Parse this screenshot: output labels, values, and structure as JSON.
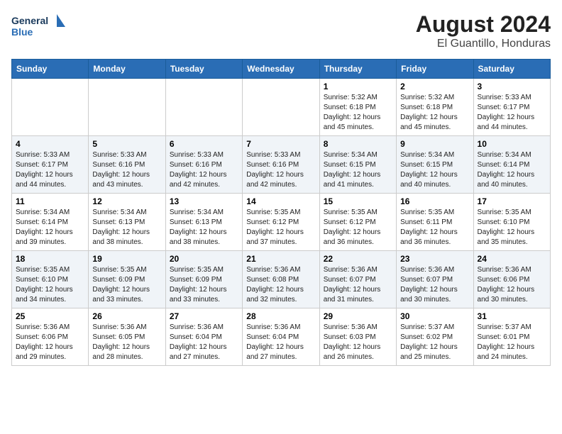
{
  "logo": {
    "line1": "General",
    "line2": "Blue"
  },
  "title": "August 2024",
  "subtitle": "El Guantillo, Honduras",
  "weekdays": [
    "Sunday",
    "Monday",
    "Tuesday",
    "Wednesday",
    "Thursday",
    "Friday",
    "Saturday"
  ],
  "weeks": [
    [
      {
        "day": "",
        "info": ""
      },
      {
        "day": "",
        "info": ""
      },
      {
        "day": "",
        "info": ""
      },
      {
        "day": "",
        "info": ""
      },
      {
        "day": "1",
        "info": "Sunrise: 5:32 AM\nSunset: 6:18 PM\nDaylight: 12 hours\nand 45 minutes."
      },
      {
        "day": "2",
        "info": "Sunrise: 5:32 AM\nSunset: 6:18 PM\nDaylight: 12 hours\nand 45 minutes."
      },
      {
        "day": "3",
        "info": "Sunrise: 5:33 AM\nSunset: 6:17 PM\nDaylight: 12 hours\nand 44 minutes."
      }
    ],
    [
      {
        "day": "4",
        "info": "Sunrise: 5:33 AM\nSunset: 6:17 PM\nDaylight: 12 hours\nand 44 minutes."
      },
      {
        "day": "5",
        "info": "Sunrise: 5:33 AM\nSunset: 6:16 PM\nDaylight: 12 hours\nand 43 minutes."
      },
      {
        "day": "6",
        "info": "Sunrise: 5:33 AM\nSunset: 6:16 PM\nDaylight: 12 hours\nand 42 minutes."
      },
      {
        "day": "7",
        "info": "Sunrise: 5:33 AM\nSunset: 6:16 PM\nDaylight: 12 hours\nand 42 minutes."
      },
      {
        "day": "8",
        "info": "Sunrise: 5:34 AM\nSunset: 6:15 PM\nDaylight: 12 hours\nand 41 minutes."
      },
      {
        "day": "9",
        "info": "Sunrise: 5:34 AM\nSunset: 6:15 PM\nDaylight: 12 hours\nand 40 minutes."
      },
      {
        "day": "10",
        "info": "Sunrise: 5:34 AM\nSunset: 6:14 PM\nDaylight: 12 hours\nand 40 minutes."
      }
    ],
    [
      {
        "day": "11",
        "info": "Sunrise: 5:34 AM\nSunset: 6:14 PM\nDaylight: 12 hours\nand 39 minutes."
      },
      {
        "day": "12",
        "info": "Sunrise: 5:34 AM\nSunset: 6:13 PM\nDaylight: 12 hours\nand 38 minutes."
      },
      {
        "day": "13",
        "info": "Sunrise: 5:34 AM\nSunset: 6:13 PM\nDaylight: 12 hours\nand 38 minutes."
      },
      {
        "day": "14",
        "info": "Sunrise: 5:35 AM\nSunset: 6:12 PM\nDaylight: 12 hours\nand 37 minutes."
      },
      {
        "day": "15",
        "info": "Sunrise: 5:35 AM\nSunset: 6:12 PM\nDaylight: 12 hours\nand 36 minutes."
      },
      {
        "day": "16",
        "info": "Sunrise: 5:35 AM\nSunset: 6:11 PM\nDaylight: 12 hours\nand 36 minutes."
      },
      {
        "day": "17",
        "info": "Sunrise: 5:35 AM\nSunset: 6:10 PM\nDaylight: 12 hours\nand 35 minutes."
      }
    ],
    [
      {
        "day": "18",
        "info": "Sunrise: 5:35 AM\nSunset: 6:10 PM\nDaylight: 12 hours\nand 34 minutes."
      },
      {
        "day": "19",
        "info": "Sunrise: 5:35 AM\nSunset: 6:09 PM\nDaylight: 12 hours\nand 33 minutes."
      },
      {
        "day": "20",
        "info": "Sunrise: 5:35 AM\nSunset: 6:09 PM\nDaylight: 12 hours\nand 33 minutes."
      },
      {
        "day": "21",
        "info": "Sunrise: 5:36 AM\nSunset: 6:08 PM\nDaylight: 12 hours\nand 32 minutes."
      },
      {
        "day": "22",
        "info": "Sunrise: 5:36 AM\nSunset: 6:07 PM\nDaylight: 12 hours\nand 31 minutes."
      },
      {
        "day": "23",
        "info": "Sunrise: 5:36 AM\nSunset: 6:07 PM\nDaylight: 12 hours\nand 30 minutes."
      },
      {
        "day": "24",
        "info": "Sunrise: 5:36 AM\nSunset: 6:06 PM\nDaylight: 12 hours\nand 30 minutes."
      }
    ],
    [
      {
        "day": "25",
        "info": "Sunrise: 5:36 AM\nSunset: 6:06 PM\nDaylight: 12 hours\nand 29 minutes."
      },
      {
        "day": "26",
        "info": "Sunrise: 5:36 AM\nSunset: 6:05 PM\nDaylight: 12 hours\nand 28 minutes."
      },
      {
        "day": "27",
        "info": "Sunrise: 5:36 AM\nSunset: 6:04 PM\nDaylight: 12 hours\nand 27 minutes."
      },
      {
        "day": "28",
        "info": "Sunrise: 5:36 AM\nSunset: 6:04 PM\nDaylight: 12 hours\nand 27 minutes."
      },
      {
        "day": "29",
        "info": "Sunrise: 5:36 AM\nSunset: 6:03 PM\nDaylight: 12 hours\nand 26 minutes."
      },
      {
        "day": "30",
        "info": "Sunrise: 5:37 AM\nSunset: 6:02 PM\nDaylight: 12 hours\nand 25 minutes."
      },
      {
        "day": "31",
        "info": "Sunrise: 5:37 AM\nSunset: 6:01 PM\nDaylight: 12 hours\nand 24 minutes."
      }
    ]
  ]
}
